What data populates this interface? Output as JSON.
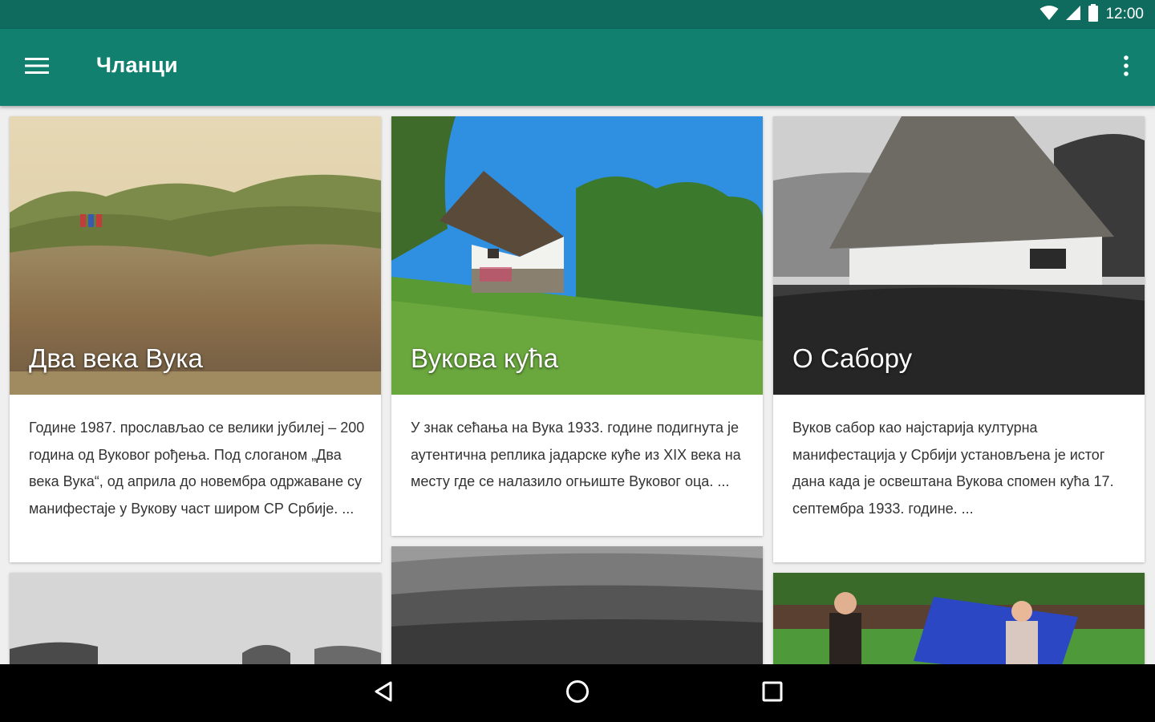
{
  "status_bar": {
    "time": "12:00"
  },
  "app_bar": {
    "title": "Чланци"
  },
  "cards": [
    {
      "title": "Два века Вука",
      "excerpt": "Године 1987. прослављао се велики јубилеј – 200 година од Вуковог рођења. Под слоганом „Два века Вука“, од априла до новембра одржаване су манифестаје у Вукову част широм СР Србије. ..."
    },
    {
      "title": "Вукова кућа",
      "excerpt": "У знак сећања на Вука 1933. године подигнута је аутентична реплика јадарске куће из XIX века на месту где се налазило огњиште Вуковог оца. ..."
    },
    {
      "title": "О Сабору",
      "excerpt": "Вуков сабор као најстарија културна манифестација у Србији установљена је истог дана када је освештана Вукова спомен кућа 17. септембра 1933. године. ..."
    }
  ],
  "colors": {
    "status_bar": "#0e6b5e",
    "app_bar": "#11806f",
    "nav_bar": "#000000"
  },
  "icons": [
    "wifi-icon",
    "signal-icon",
    "battery-icon",
    "menu-icon",
    "more-vert-icon",
    "back-icon",
    "home-icon",
    "recents-icon"
  ]
}
